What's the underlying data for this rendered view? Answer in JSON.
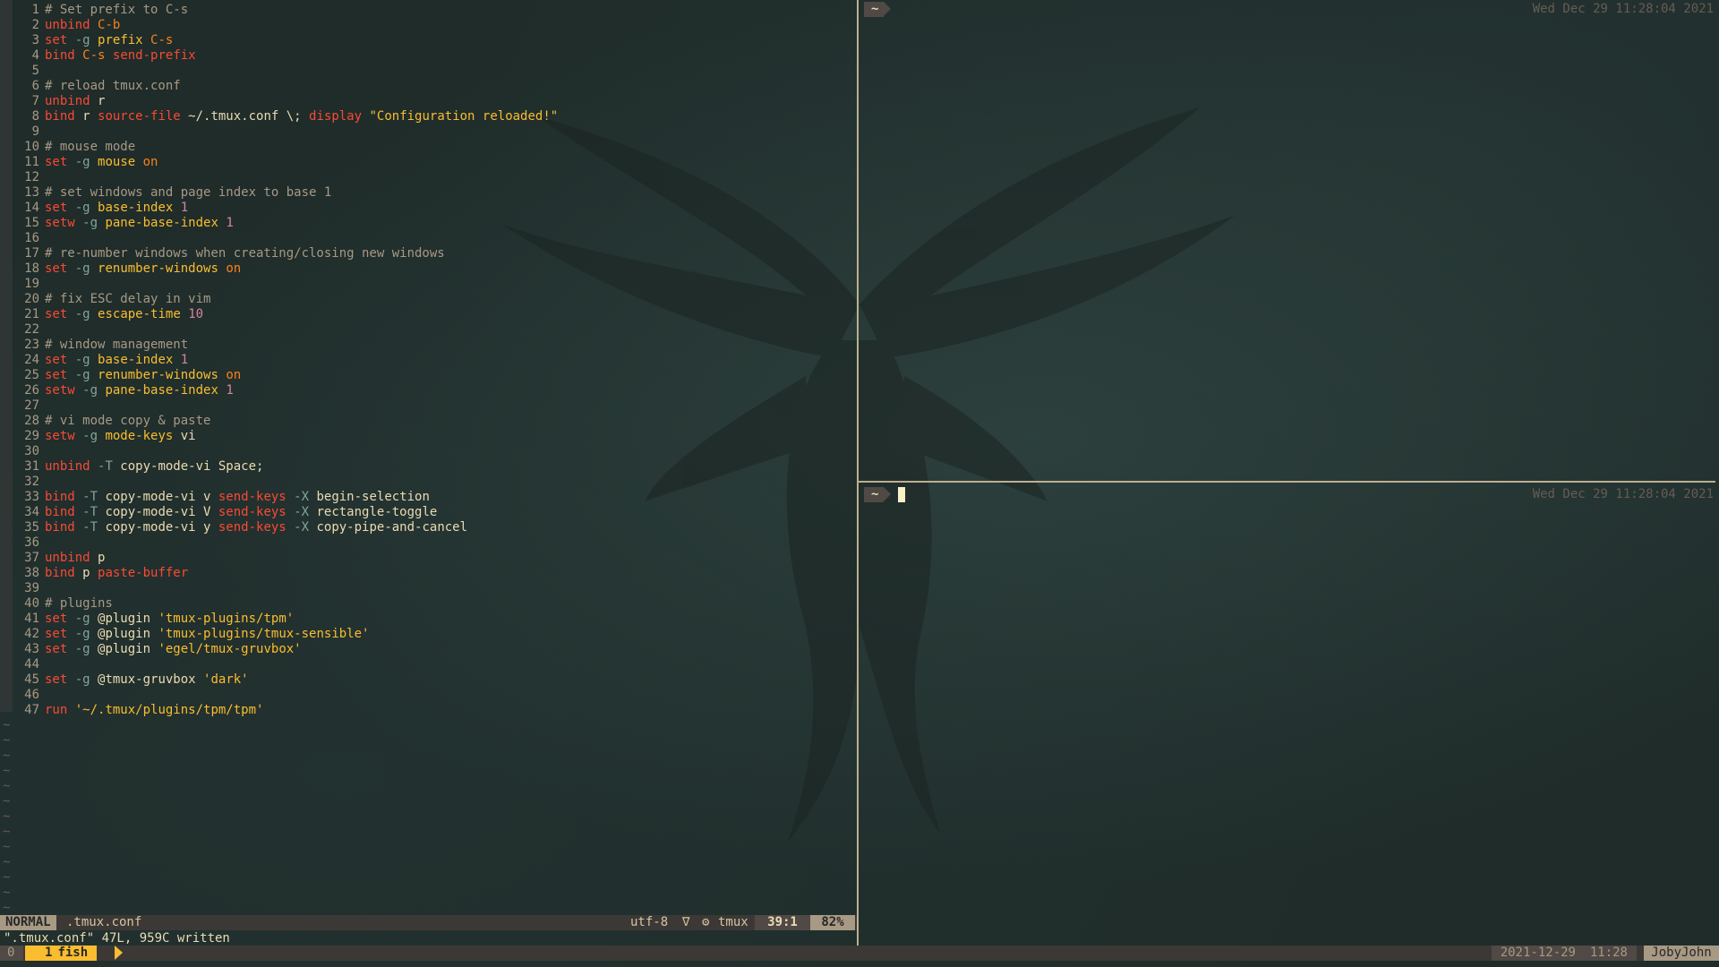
{
  "vim": {
    "lines": [
      {
        "n": "1",
        "segs": [
          [
            "c",
            "# Set prefix to C-s"
          ]
        ]
      },
      {
        "n": "2",
        "segs": [
          [
            "k",
            "unbind"
          ],
          [
            "w",
            " "
          ],
          [
            "o",
            "C-b"
          ]
        ]
      },
      {
        "n": "3",
        "segs": [
          [
            "k",
            "set"
          ],
          [
            "w",
            " "
          ],
          [
            "b",
            "-g"
          ],
          [
            "w",
            " "
          ],
          [
            "y",
            "prefix"
          ],
          [
            "w",
            " "
          ],
          [
            "o",
            "C-s"
          ]
        ]
      },
      {
        "n": "4",
        "segs": [
          [
            "k",
            "bind"
          ],
          [
            "w",
            " "
          ],
          [
            "o",
            "C-s"
          ],
          [
            "w",
            " "
          ],
          [
            "k",
            "send-prefix"
          ]
        ]
      },
      {
        "n": "5",
        "segs": []
      },
      {
        "n": "6",
        "segs": [
          [
            "c",
            "# reload tmux.conf"
          ]
        ]
      },
      {
        "n": "7",
        "segs": [
          [
            "k",
            "unbind"
          ],
          [
            "w",
            " r"
          ]
        ]
      },
      {
        "n": "8",
        "segs": [
          [
            "k",
            "bind"
          ],
          [
            "w",
            " r "
          ],
          [
            "k",
            "source-file"
          ],
          [
            "w",
            " ~/.tmux.conf \\; "
          ],
          [
            "k",
            "display"
          ],
          [
            "w",
            " "
          ],
          [
            "y",
            "\"Configuration reloaded!\""
          ]
        ]
      },
      {
        "n": "9",
        "segs": []
      },
      {
        "n": "10",
        "segs": [
          [
            "c",
            "# mouse mode"
          ]
        ]
      },
      {
        "n": "11",
        "segs": [
          [
            "k",
            "set"
          ],
          [
            "w",
            " "
          ],
          [
            "b",
            "-g"
          ],
          [
            "w",
            " "
          ],
          [
            "y",
            "mouse"
          ],
          [
            "w",
            " "
          ],
          [
            "o",
            "on"
          ]
        ]
      },
      {
        "n": "12",
        "segs": []
      },
      {
        "n": "13",
        "segs": [
          [
            "c",
            "# set windows and page index to base 1"
          ]
        ]
      },
      {
        "n": "14",
        "segs": [
          [
            "k",
            "set"
          ],
          [
            "w",
            " "
          ],
          [
            "b",
            "-g"
          ],
          [
            "w",
            " "
          ],
          [
            "y",
            "base-index"
          ],
          [
            "w",
            " "
          ],
          [
            "p",
            "1"
          ]
        ]
      },
      {
        "n": "15",
        "segs": [
          [
            "k",
            "setw"
          ],
          [
            "w",
            " "
          ],
          [
            "b",
            "-g"
          ],
          [
            "w",
            " "
          ],
          [
            "y",
            "pane-base-index"
          ],
          [
            "w",
            " "
          ],
          [
            "p",
            "1"
          ]
        ]
      },
      {
        "n": "16",
        "segs": []
      },
      {
        "n": "17",
        "segs": [
          [
            "c",
            "# re-number windows when creating/closing new windows"
          ]
        ]
      },
      {
        "n": "18",
        "segs": [
          [
            "k",
            "set"
          ],
          [
            "w",
            " "
          ],
          [
            "b",
            "-g"
          ],
          [
            "w",
            " "
          ],
          [
            "y",
            "renumber-windows"
          ],
          [
            "w",
            " "
          ],
          [
            "o",
            "on"
          ]
        ]
      },
      {
        "n": "19",
        "segs": []
      },
      {
        "n": "20",
        "segs": [
          [
            "c",
            "# fix ESC delay in vim"
          ]
        ]
      },
      {
        "n": "21",
        "segs": [
          [
            "k",
            "set"
          ],
          [
            "w",
            " "
          ],
          [
            "b",
            "-g"
          ],
          [
            "w",
            " "
          ],
          [
            "y",
            "escape-time"
          ],
          [
            "w",
            " "
          ],
          [
            "p",
            "10"
          ]
        ]
      },
      {
        "n": "22",
        "segs": []
      },
      {
        "n": "23",
        "segs": [
          [
            "c",
            "# window management"
          ]
        ]
      },
      {
        "n": "24",
        "segs": [
          [
            "k",
            "set"
          ],
          [
            "w",
            " "
          ],
          [
            "b",
            "-g"
          ],
          [
            "w",
            " "
          ],
          [
            "y",
            "base-index"
          ],
          [
            "w",
            " "
          ],
          [
            "p",
            "1"
          ]
        ]
      },
      {
        "n": "25",
        "segs": [
          [
            "k",
            "set"
          ],
          [
            "w",
            " "
          ],
          [
            "b",
            "-g"
          ],
          [
            "w",
            " "
          ],
          [
            "y",
            "renumber-windows"
          ],
          [
            "w",
            " "
          ],
          [
            "o",
            "on"
          ]
        ]
      },
      {
        "n": "26",
        "segs": [
          [
            "k",
            "setw"
          ],
          [
            "w",
            " "
          ],
          [
            "b",
            "-g"
          ],
          [
            "w",
            " "
          ],
          [
            "y",
            "pane-base-index"
          ],
          [
            "w",
            " "
          ],
          [
            "p",
            "1"
          ]
        ]
      },
      {
        "n": "27",
        "segs": []
      },
      {
        "n": "28",
        "segs": [
          [
            "c",
            "# vi mode copy & paste"
          ]
        ]
      },
      {
        "n": "29",
        "segs": [
          [
            "k",
            "setw"
          ],
          [
            "w",
            " "
          ],
          [
            "b",
            "-g"
          ],
          [
            "w",
            " "
          ],
          [
            "y",
            "mode-keys"
          ],
          [
            "w",
            " vi"
          ]
        ]
      },
      {
        "n": "30",
        "segs": []
      },
      {
        "n": "31",
        "segs": [
          [
            "k",
            "unbind"
          ],
          [
            "w",
            " "
          ],
          [
            "b",
            "-T"
          ],
          [
            "w",
            " copy-mode-vi Space;"
          ]
        ]
      },
      {
        "n": "32",
        "segs": []
      },
      {
        "n": "33",
        "segs": [
          [
            "k",
            "bind"
          ],
          [
            "w",
            " "
          ],
          [
            "b",
            "-T"
          ],
          [
            "w",
            " copy-mode-vi v "
          ],
          [
            "k",
            "send-keys"
          ],
          [
            "w",
            " "
          ],
          [
            "b",
            "-X"
          ],
          [
            "w",
            " begin-selection"
          ]
        ]
      },
      {
        "n": "34",
        "segs": [
          [
            "k",
            "bind"
          ],
          [
            "w",
            " "
          ],
          [
            "b",
            "-T"
          ],
          [
            "w",
            " copy-mode-vi V "
          ],
          [
            "k",
            "send-keys"
          ],
          [
            "w",
            " "
          ],
          [
            "b",
            "-X"
          ],
          [
            "w",
            " rectangle-toggle"
          ]
        ]
      },
      {
        "n": "35",
        "segs": [
          [
            "k",
            "bind"
          ],
          [
            "w",
            " "
          ],
          [
            "b",
            "-T"
          ],
          [
            "w",
            " copy-mode-vi y "
          ],
          [
            "k",
            "send-keys"
          ],
          [
            "w",
            " "
          ],
          [
            "b",
            "-X"
          ],
          [
            "w",
            " copy-pipe-and-cancel"
          ]
        ]
      },
      {
        "n": "36",
        "segs": []
      },
      {
        "n": "37",
        "segs": [
          [
            "k",
            "unbind"
          ],
          [
            "w",
            " p"
          ]
        ]
      },
      {
        "n": "38",
        "segs": [
          [
            "k",
            "bind"
          ],
          [
            "w",
            " p "
          ],
          [
            "k",
            "paste-buffer"
          ]
        ]
      },
      {
        "n": "39",
        "segs": []
      },
      {
        "n": "40",
        "segs": [
          [
            "c",
            "# plugins"
          ]
        ]
      },
      {
        "n": "41",
        "segs": [
          [
            "k",
            "set"
          ],
          [
            "w",
            " "
          ],
          [
            "b",
            "-g"
          ],
          [
            "w",
            " @plugin "
          ],
          [
            "y",
            "'tmux-plugins/tpm'"
          ]
        ]
      },
      {
        "n": "42",
        "segs": [
          [
            "k",
            "set"
          ],
          [
            "w",
            " "
          ],
          [
            "b",
            "-g"
          ],
          [
            "w",
            " @plugin "
          ],
          [
            "y",
            "'tmux-plugins/tmux-sensible'"
          ]
        ]
      },
      {
        "n": "43",
        "segs": [
          [
            "k",
            "set"
          ],
          [
            "w",
            " "
          ],
          [
            "b",
            "-g"
          ],
          [
            "w",
            " @plugin "
          ],
          [
            "y",
            "'egel/tmux-gruvbox'"
          ]
        ]
      },
      {
        "n": "44",
        "segs": []
      },
      {
        "n": "45",
        "segs": [
          [
            "k",
            "set"
          ],
          [
            "w",
            " "
          ],
          [
            "b",
            "-g"
          ],
          [
            "w",
            " @tmux-gruvbox "
          ],
          [
            "y",
            "'dark'"
          ]
        ]
      },
      {
        "n": "46",
        "segs": []
      },
      {
        "n": "47",
        "segs": [
          [
            "k",
            "run"
          ],
          [
            "w",
            " "
          ],
          [
            "y",
            "'~/.tmux/plugins/tpm/tpm'"
          ]
        ]
      }
    ],
    "tilde_count": 13,
    "tilde": "~",
    "status": {
      "mode": "NORMAL",
      "file": ".tmux.conf",
      "encoding": "utf-8",
      "os_icon": "∇",
      "gear_icon": "⚙",
      "filetype": "tmux",
      "position": "39:1",
      "percent": "82%"
    },
    "message": "\".tmux.conf\" 47L, 959C written"
  },
  "panes": {
    "top": {
      "prompt": "~",
      "clock": "Wed Dec 29 11:28:04 2021"
    },
    "bottom": {
      "prompt": "~",
      "clock": "Wed Dec 29 11:28:04 2021"
    }
  },
  "tmux": {
    "session": "0",
    "window_index": "1",
    "window_name": "fish",
    "date": "2021-12-29",
    "time": "11:28",
    "host": "JobyJohn"
  },
  "colors": {
    "comment": "#a89984",
    "keyword": "#fb4934",
    "option": "#fabd2f",
    "value_orange": "#fe8019",
    "value_number": "#d3869b",
    "status_accent": "#fabd2f",
    "background": "#1f2c2a"
  }
}
